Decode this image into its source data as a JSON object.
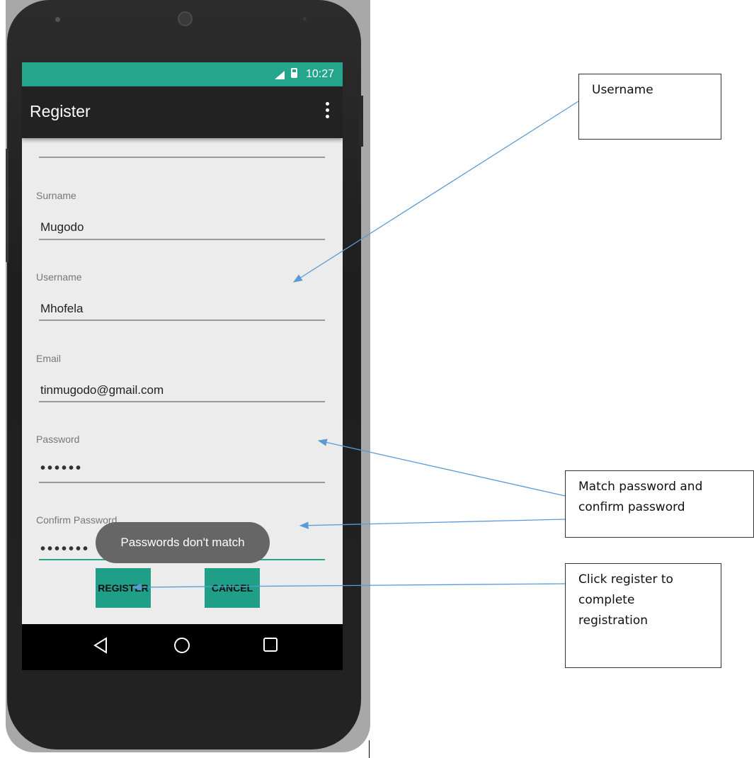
{
  "status_bar": {
    "time": "10:27"
  },
  "app_bar": {
    "title": "Register"
  },
  "form": {
    "surname_label": "Surname",
    "surname_value": "Mugodo",
    "username_label": "Username",
    "username_value": "Mhofela",
    "email_label": "Email",
    "email_value": "tinmugodo@gmail.com",
    "password_label": "Password",
    "password_value": "••••••",
    "confirm_label": "Confirm Password",
    "confirm_value": "•••••••"
  },
  "toast": {
    "message": "Passwords don't match"
  },
  "buttons": {
    "register_label": "REGISTER",
    "cancel_label": "CANCEL"
  },
  "nav_bar": {
    "icons": [
      "back-icon",
      "home-icon",
      "recents-icon"
    ]
  },
  "annotations": {
    "username_note": "Username",
    "password_note_line1": "Match password and",
    "password_note_line2": "confirm password",
    "register_note_line1": "Click register to",
    "register_note_line2": "complete",
    "register_note_line3": "registration"
  },
  "colors": {
    "accent": "#24a58c",
    "button": "#1f9e88",
    "app_bar": "#222222",
    "toast": "#666666",
    "arrow": "#5b9bd5"
  }
}
